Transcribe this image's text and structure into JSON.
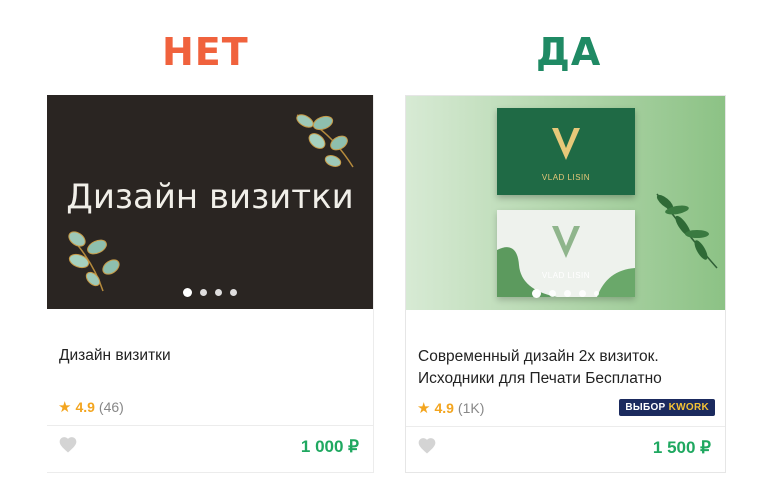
{
  "headings": {
    "no": "НЕТ",
    "yes": "ДА"
  },
  "cards": [
    {
      "image_text": "Дизайн визитки",
      "title_lines": [
        "Дизайн визитки"
      ],
      "rating": "4.9",
      "reviews": "(46)",
      "price": "1 000 ₽"
    },
    {
      "business_card_name": "VLAD LISIN",
      "title_lines": [
        "Современный дизайн 2х визиток.",
        "Исходники для Печати Бесплатно"
      ],
      "rating": "4.9",
      "reviews": "(1K)",
      "badge_prefix": "ВЫБОР",
      "badge_brand": "KWORK",
      "price": "1 500 ₽"
    }
  ],
  "colors": {
    "no": "#f0623d",
    "yes": "#1f8a64",
    "price": "#1fa860",
    "star": "#f3a51f",
    "badge_bg": "#1b2a5e"
  },
  "icons": [
    "star-icon",
    "heart-icon",
    "leaf-decor",
    "v-logo"
  ]
}
